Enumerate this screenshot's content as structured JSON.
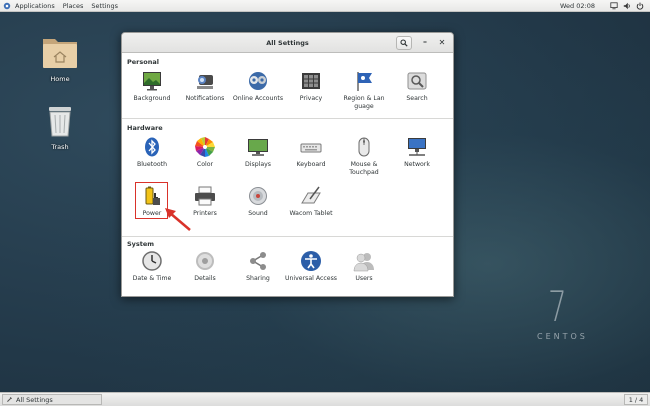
{
  "top_panel": {
    "menus": [
      "Applications",
      "Places",
      "Settings"
    ],
    "clock": "Wed 02:08"
  },
  "desktop": {
    "icons": [
      {
        "label": "Home"
      },
      {
        "label": "Trash"
      }
    ],
    "watermark_number": "7",
    "watermark_text": "CENTOS"
  },
  "window": {
    "title": "All Settings",
    "minimize_glyph": "–",
    "close_glyph": "✕",
    "sections": [
      {
        "title": "Personal",
        "items": [
          {
            "label": "Background",
            "icon": "background-icon"
          },
          {
            "label": "Notifications",
            "icon": "notifications-icon"
          },
          {
            "label": "Online Accounts",
            "icon": "online-accounts-icon"
          },
          {
            "label": "Privacy",
            "icon": "privacy-icon"
          },
          {
            "label": "Region & Lan guage",
            "icon": "region-language-icon"
          },
          {
            "label": "Search",
            "icon": "search-icon"
          }
        ]
      },
      {
        "title": "Hardware",
        "items": [
          {
            "label": "Bluetooth",
            "icon": "bluetooth-icon"
          },
          {
            "label": "Color",
            "icon": "color-icon"
          },
          {
            "label": "Displays",
            "icon": "displays-icon"
          },
          {
            "label": "Keyboard",
            "icon": "keyboard-icon"
          },
          {
            "label": "Mouse & Touchpad",
            "icon": "mouse-icon"
          },
          {
            "label": "Network",
            "icon": "network-icon"
          },
          {
            "label": "Power",
            "icon": "power-icon"
          },
          {
            "label": "Printers",
            "icon": "printer-icon"
          },
          {
            "label": "Sound",
            "icon": "sound-icon"
          },
          {
            "label": "Wacom Tablet",
            "icon": "wacom-tablet-icon"
          }
        ]
      },
      {
        "title": "System",
        "items": [
          {
            "label": "Date & Time",
            "icon": "clock-icon"
          },
          {
            "label": "Details",
            "icon": "details-icon"
          },
          {
            "label": "Sharing",
            "icon": "sharing-icon"
          },
          {
            "label": "Universal Access",
            "icon": "universal-access-icon"
          },
          {
            "label": "Users",
            "icon": "users-icon"
          }
        ]
      }
    ]
  },
  "taskbar": {
    "task_label": "All Settings",
    "workspace": "1 / 4"
  },
  "colors": {
    "highlight": "#d9322a",
    "desktop_bg": "#223848"
  }
}
